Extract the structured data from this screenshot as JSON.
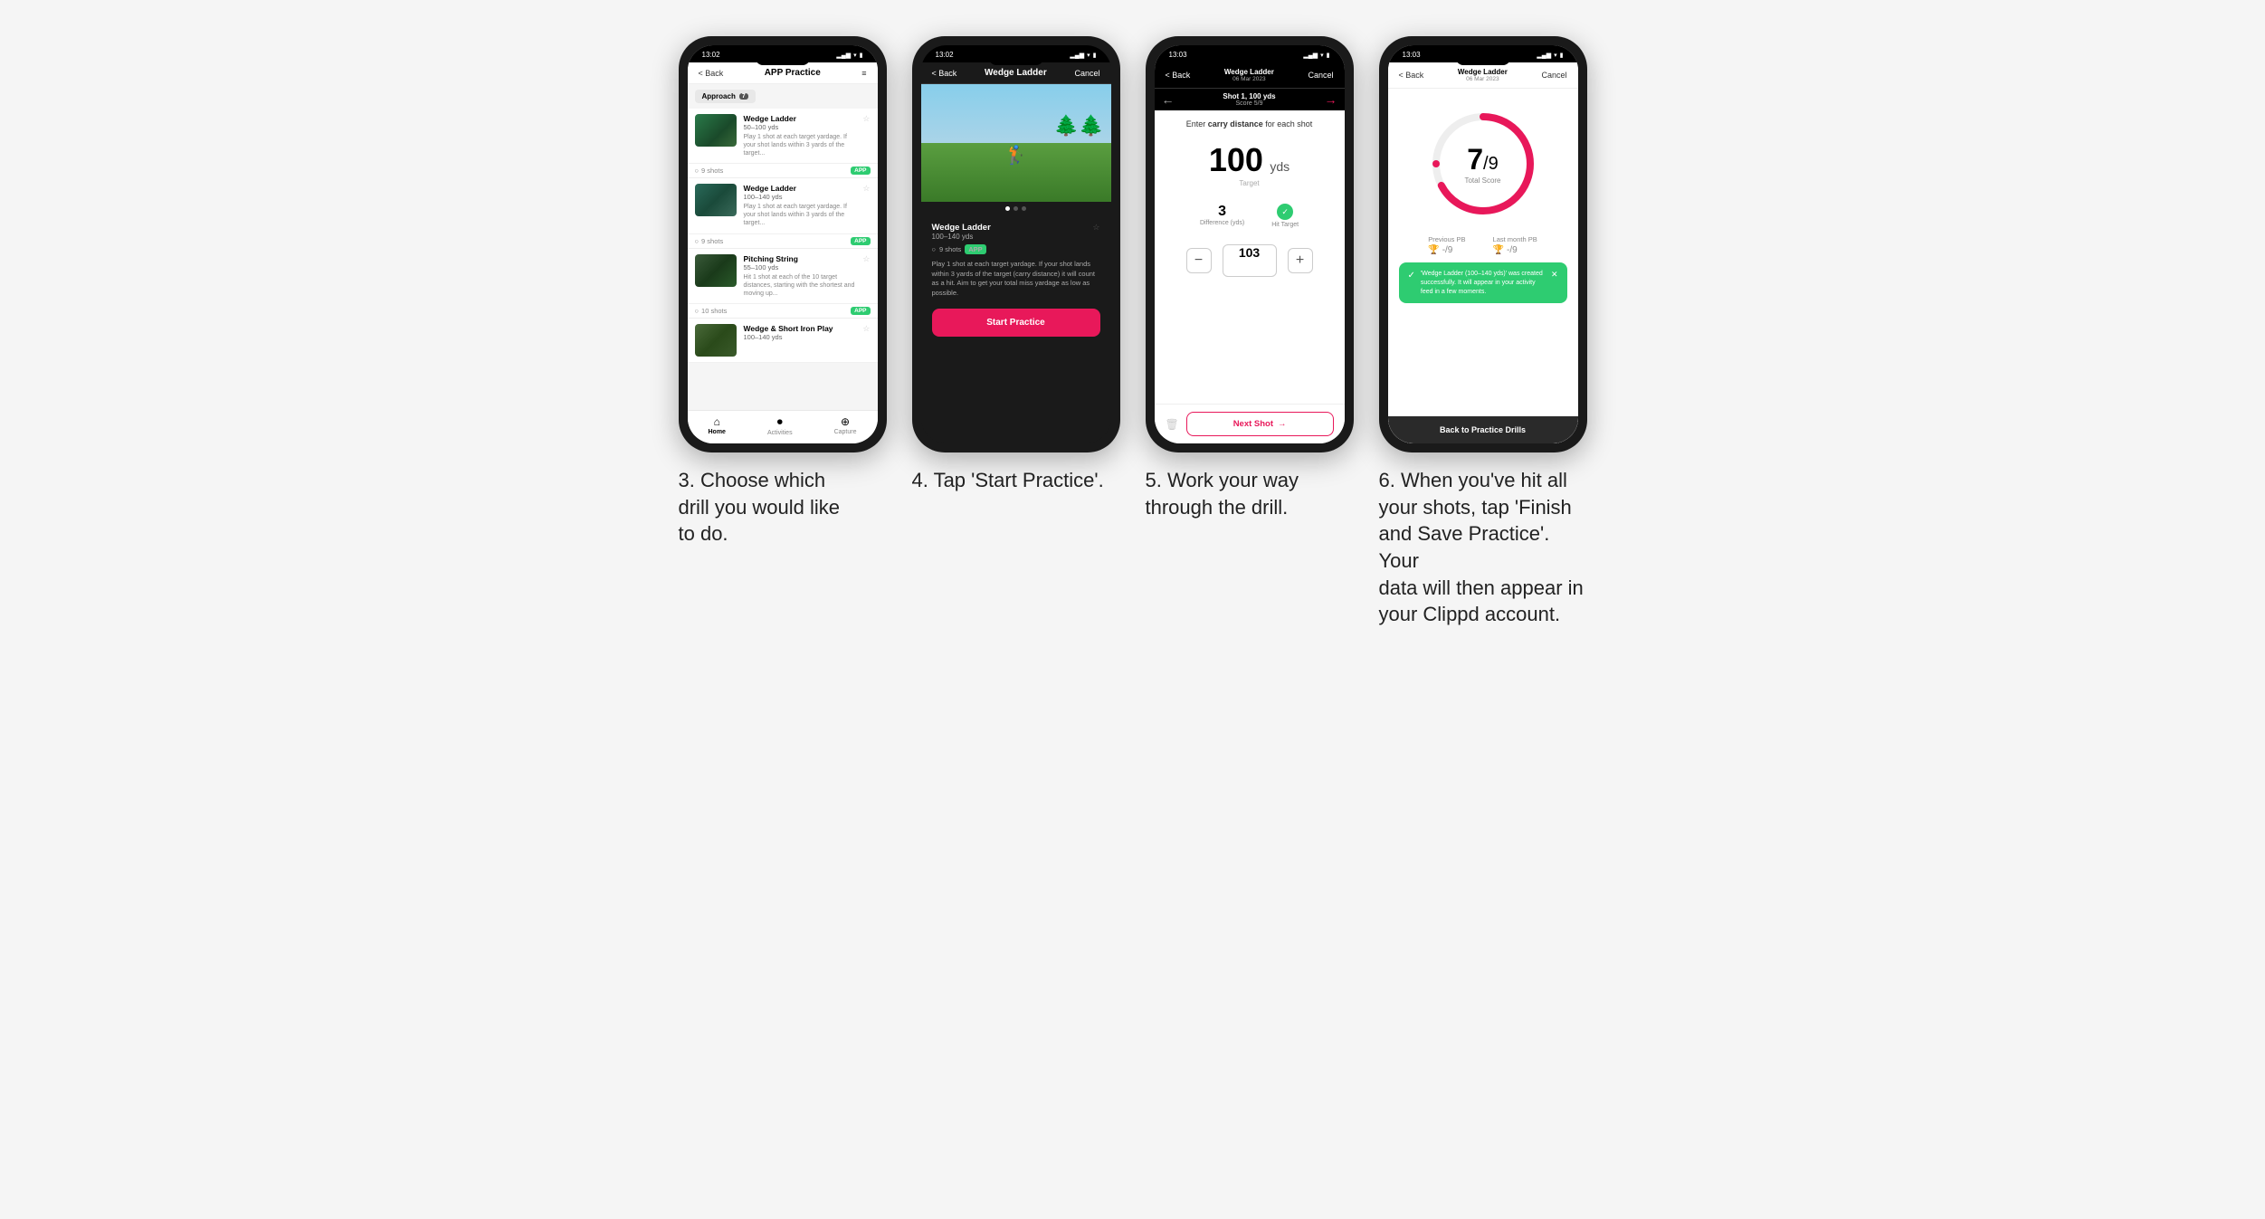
{
  "phones": [
    {
      "id": "phone1",
      "status_time": "13:02",
      "nav_back": "< Back",
      "nav_title": "APP Practice",
      "nav_right": "≡",
      "category": "Approach",
      "category_count": "7",
      "drills": [
        {
          "name": "Wedge Ladder",
          "range": "50–100 yds",
          "desc": "Play 1 shot at each target yardage. If your shot lands within 3 yards of the target...",
          "shots": "9 shots",
          "badge": "APP"
        },
        {
          "name": "Wedge Ladder",
          "range": "100–140 yds",
          "desc": "Play 1 shot at each target yardage. If your shot lands within 3 yards of the target...",
          "shots": "9 shots",
          "badge": "APP"
        },
        {
          "name": "Pitching String",
          "range": "55–100 yds",
          "desc": "Hit 1 shot at each of the 10 target distances, starting with the shortest and moving up...",
          "shots": "10 shots",
          "badge": "APP"
        },
        {
          "name": "Wedge & Short Iron Play",
          "range": "100–140 yds",
          "desc": "",
          "shots": "",
          "badge": ""
        }
      ],
      "tabs": [
        {
          "label": "Home",
          "icon": "🏠",
          "active": true
        },
        {
          "label": "Activities",
          "icon": "📊",
          "active": false
        },
        {
          "label": "Capture",
          "icon": "⊕",
          "active": false
        }
      ]
    },
    {
      "id": "phone2",
      "status_time": "13:02",
      "nav_back": "< Back",
      "nav_title": "Wedge Ladder",
      "nav_right": "Cancel",
      "drill_name": "Wedge Ladder",
      "drill_range": "100–140 yds",
      "drill_shots": "9 shots",
      "drill_badge": "APP",
      "drill_desc": "Play 1 shot at each target yardage. If your shot lands within 3 yards of the target (carry distance) it will count as a hit. Aim to get your total miss yardage as low as possible.",
      "start_button": "Start Practice"
    },
    {
      "id": "phone3",
      "status_time": "13:03",
      "nav_back": "< Back",
      "nav_title_line1": "Wedge Ladder",
      "nav_title_line2": "06 Mar 2023",
      "nav_right": "Cancel",
      "shot_label": "Shot 1, 100 yds",
      "score_label": "Score 5/9",
      "carry_instruction": "Enter carry distance for each shot",
      "target_yds": "100",
      "target_unit": "yds",
      "target_label": "Target",
      "difference_value": "3",
      "difference_label": "Difference (yds)",
      "hit_target_label": "Hit Target",
      "input_value": "103",
      "next_shot_label": "Next Shot"
    },
    {
      "id": "phone4",
      "status_time": "13:03",
      "nav_back": "< Back",
      "nav_title_line1": "Wedge Ladder",
      "nav_title_line2": "06 Mar 2023",
      "nav_right": "Cancel",
      "score_numerator": "7",
      "score_denominator": "/9",
      "total_score_label": "Total Score",
      "prev_pb_label": "Previous PB",
      "prev_pb_value": "-/9",
      "last_month_pb_label": "Last month PB",
      "last_month_pb_value": "-/9",
      "toast_text": "'Wedge Ladder (100–140 yds)' was created successfully. It will appear in your activity feed in a few moments.",
      "back_button": "Back to Practice Drills"
    }
  ],
  "captions": [
    "3. Choose which\ndrill you would like\nto do.",
    "4. Tap 'Start Practice'.",
    "5. Work your way\nthrough the drill.",
    "6. When you've hit all\nyour shots, tap 'Finish\nand Save Practice'. Your\ndata will then appear in\nyour Clippd account."
  ]
}
